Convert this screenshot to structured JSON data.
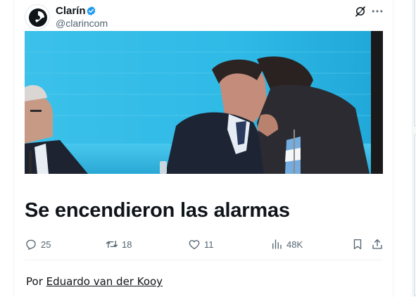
{
  "tweet": {
    "author_name": "Clarín",
    "author_handle": "@clarincom",
    "headline": "Se encendieron las alarmas",
    "actions": {
      "replies": "25",
      "retweets": "18",
      "likes": "11",
      "views": "48K"
    }
  },
  "article": {
    "byline_prefix": "Por",
    "byline_author": "Eduardo van der Kooy"
  },
  "icons": {
    "verified": "verified-badge-icon",
    "grok": "grok-icon",
    "more": "more-icon",
    "reply": "reply-icon",
    "retweet": "retweet-icon",
    "like": "heart-icon",
    "views": "views-icon",
    "bookmark": "bookmark-icon",
    "share": "share-icon"
  },
  "colors": {
    "verified_blue": "#1d9bf0",
    "text_primary": "#0f1419",
    "text_secondary": "#536471",
    "divider": "#eff3f4",
    "media_background": "#29b7e4"
  }
}
